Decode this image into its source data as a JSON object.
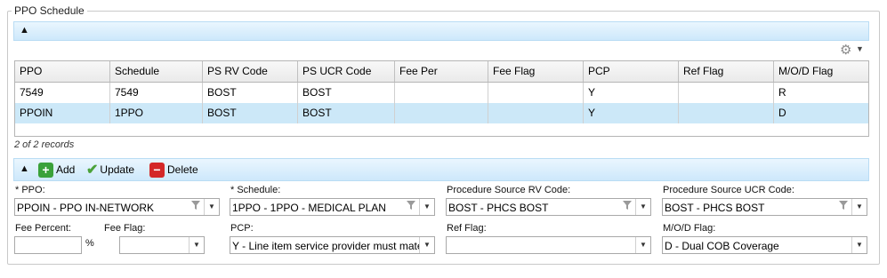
{
  "panel": {
    "title": "PPO Schedule"
  },
  "grid": {
    "columns": [
      "PPO",
      "Schedule",
      "PS RV Code",
      "PS UCR Code",
      "Fee Per",
      "Fee Flag",
      "PCP",
      "Ref Flag",
      "M/O/D Flag"
    ],
    "rows": [
      [
        "7549",
        "7549",
        "BOST",
        "BOST",
        "",
        "",
        "Y",
        "",
        "R"
      ],
      [
        "PPOIN",
        "1PPO",
        "BOST",
        "BOST",
        "",
        "",
        "Y",
        "",
        "D"
      ]
    ],
    "records_text": "2 of 2 records",
    "selected_row": 1
  },
  "toolbar": {
    "add_label": "Add",
    "update_label": "Update",
    "delete_label": "Delete"
  },
  "form": {
    "ppo_label": "* PPO:",
    "ppo_value": "PPOIN - PPO IN-NETWORK",
    "schedule_label": "* Schedule:",
    "schedule_value": "1PPO - 1PPO - MEDICAL PLAN",
    "rv_label": "Procedure Source RV Code:",
    "rv_value": "BOST - PHCS BOST",
    "ucr_label": "Procedure Source UCR Code:",
    "ucr_value": "BOST - PHCS BOST",
    "fee_percent_label": "Fee Percent:",
    "fee_percent_value": "",
    "percent_sign": "%",
    "fee_flag_label": "Fee Flag:",
    "fee_flag_value": "",
    "pcp_label": "PCP:",
    "pcp_value": "Y - Line item service provider must mate",
    "ref_flag_label": "Ref Flag:",
    "ref_flag_value": "",
    "mod_flag_label": "M/O/D Flag:",
    "mod_flag_value": "D - Dual COB Coverage"
  },
  "icons": {
    "collapse": "chevron-up-icon",
    "settings": "gear-icon",
    "add": "plus-icon",
    "update": "checkmark-icon",
    "delete": "minus-icon",
    "filter": "funnel-icon"
  },
  "colors": {
    "accent_bar": "#cde8fb",
    "selected_row": "#cce8f8",
    "add": "#3aa13a",
    "delete": "#d42828"
  }
}
